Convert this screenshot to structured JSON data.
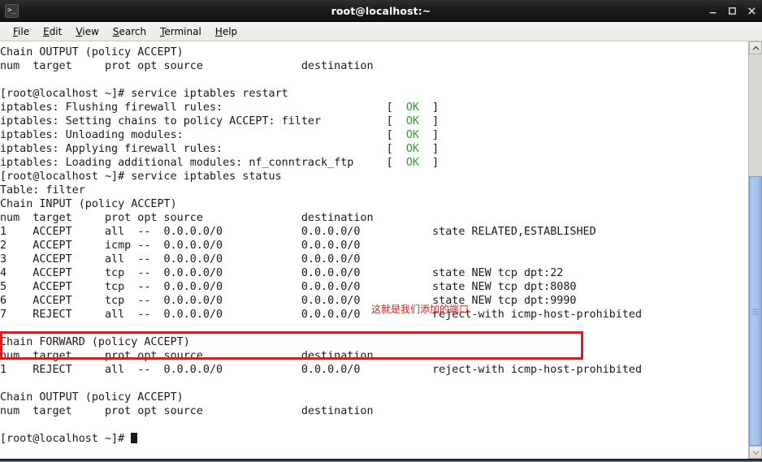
{
  "window": {
    "title": "root@localhost:~",
    "app_icon": "terminal-icon",
    "minimize_label": "–",
    "maximize_label": "□",
    "close_label": "✕"
  },
  "menubar": {
    "items": [
      {
        "label": "File",
        "accel": "F"
      },
      {
        "label": "Edit",
        "accel": "E"
      },
      {
        "label": "View",
        "accel": "V"
      },
      {
        "label": "Search",
        "accel": "S"
      },
      {
        "label": "Terminal",
        "accel": "T"
      },
      {
        "label": "Help",
        "accel": "H"
      }
    ]
  },
  "terminal": {
    "prompt": "[root@localhost ~]#",
    "ok_color": "#2f9e2f",
    "lines": [
      "Chain OUTPUT (policy ACCEPT)",
      "num  target     prot opt source               destination",
      "",
      "[root@localhost ~]# service iptables restart",
      "iptables: Flushing firewall rules:                         [  OK  ]",
      "iptables: Setting chains to policy ACCEPT: filter          [  OK  ]",
      "iptables: Unloading modules:                               [  OK  ]",
      "iptables: Applying firewall rules:                         [  OK  ]",
      "iptables: Loading additional modules: nf_conntrack_ftp     [  OK  ]",
      "[root@localhost ~]# service iptables status",
      "Table: filter",
      "Chain INPUT (policy ACCEPT)",
      "num  target     prot opt source               destination",
      "1    ACCEPT     all  --  0.0.0.0/0            0.0.0.0/0           state RELATED,ESTABLISHED",
      "2    ACCEPT     icmp --  0.0.0.0/0            0.0.0.0/0",
      "3    ACCEPT     all  --  0.0.0.0/0            0.0.0.0/0",
      "4    ACCEPT     tcp  --  0.0.0.0/0            0.0.0.0/0           state NEW tcp dpt:22",
      "5    ACCEPT     tcp  --  0.0.0.0/0            0.0.0.0/0           state NEW tcp dpt:8080",
      "6    ACCEPT     tcp  --  0.0.0.0/0            0.0.0.0/0           state NEW tcp dpt:9990",
      "7    REJECT     all  --  0.0.0.0/0            0.0.0.0/0           reject-with icmp-host-prohibited",
      "",
      "Chain FORWARD (policy ACCEPT)",
      "num  target     prot opt source               destination",
      "1    REJECT     all  --  0.0.0.0/0            0.0.0.0/0           reject-with icmp-host-prohibited",
      "",
      "Chain OUTPUT (policy ACCEPT)",
      "num  target     prot opt source               destination",
      "",
      "[root@localhost ~]# "
    ]
  },
  "annotation": {
    "text": "这就是我们添加的端口",
    "color": "#e01b1b",
    "highlight_rows": [
      "5",
      "6"
    ]
  },
  "scrollbar": {
    "up_arrow": "chevron-up-icon",
    "down_arrow": "chevron-down-icon"
  }
}
